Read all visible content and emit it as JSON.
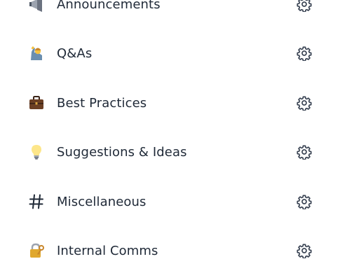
{
  "channels": [
    {
      "label": "Announcements",
      "icon": "megaphone-icon"
    },
    {
      "label": "Q&As",
      "icon": "person-raising-hand-icon"
    },
    {
      "label": "Best Practices",
      "icon": "briefcase-icon"
    },
    {
      "label": "Suggestions & Ideas",
      "icon": "light-bulb-icon"
    },
    {
      "label": "Miscellaneous",
      "icon": "hash-icon"
    },
    {
      "label": "Internal Comms",
      "icon": "locked-with-key-icon"
    }
  ],
  "settings_icon": "gear-icon",
  "colors": {
    "text": "#1f2937",
    "gear": "#374151",
    "background": "#ffffff"
  }
}
